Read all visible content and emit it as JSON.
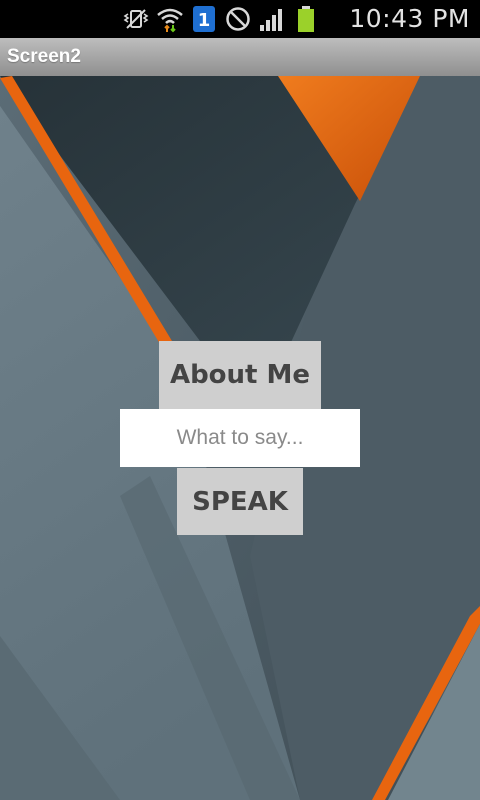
{
  "status_bar": {
    "time": "10:43 PM",
    "icons": [
      "vibrate-icon",
      "wifi-icon",
      "notification-count-icon",
      "do-not-disturb-icon",
      "signal-icon",
      "battery-icon"
    ],
    "notification_count": "1",
    "colors": {
      "battery": "#9bd12a",
      "notification_badge": "#1f6fd1",
      "wifi_arrow_up": "#e88a1a",
      "wifi_arrow_down": "#6cc81a"
    }
  },
  "title_bar": {
    "title": "Screen2"
  },
  "main": {
    "about_button_label": "About Me",
    "input": {
      "placeholder": "What to say...",
      "value": ""
    },
    "speak_button_label": "SPEAK"
  },
  "theme": {
    "accent_orange": "#e8650f",
    "background_slate": "#4e5d66",
    "button_bg": "#cfcfcf",
    "button_text": "#444444"
  }
}
